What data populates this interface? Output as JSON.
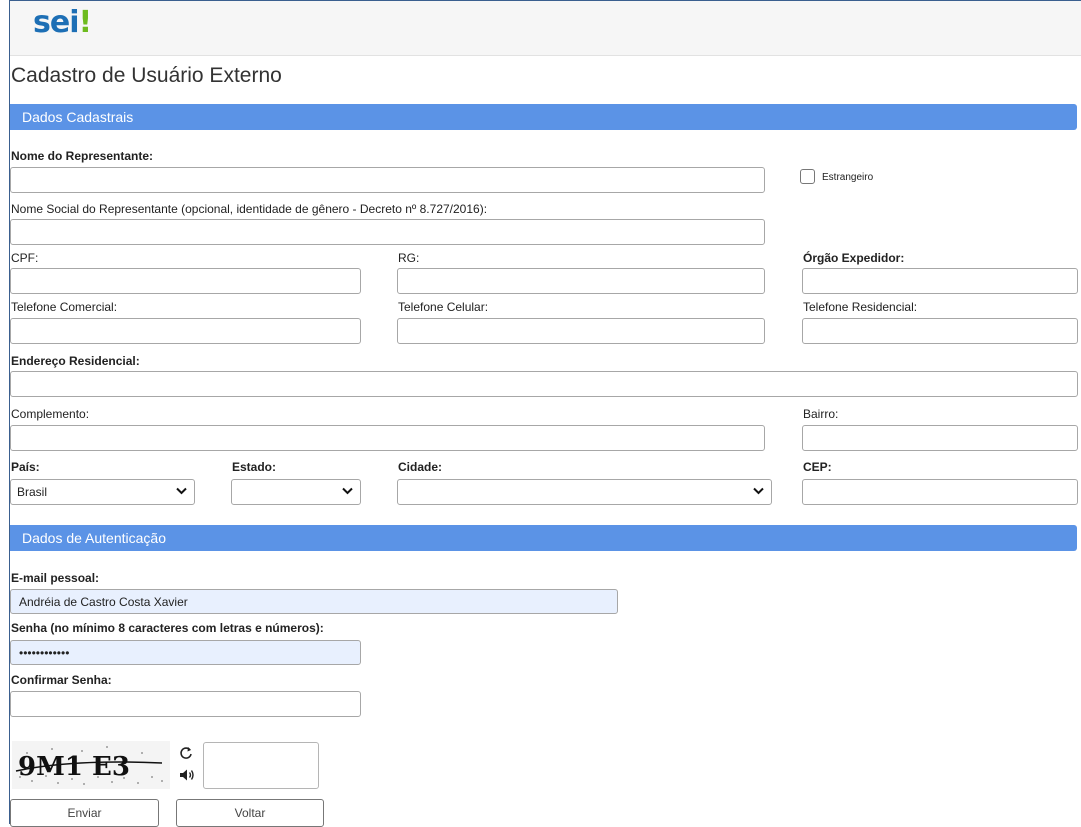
{
  "app": {
    "logo_main": "sei",
    "logo_mark": "!"
  },
  "page_title": "Cadastro de Usuário Externo",
  "sections": {
    "cadastrais": "Dados Cadastrais",
    "autenticacao": "Dados de Autenticação"
  },
  "labels": {
    "nome": "Nome do Representante:",
    "estrangeiro": "Estrangeiro",
    "nome_social": "Nome Social do Representante (opcional, identidade de gênero - Decreto nº 8.727/2016):",
    "cpf": "CPF:",
    "rg": "RG:",
    "orgao": "Órgão Expedidor:",
    "tel_comercial": "Telefone Comercial:",
    "tel_celular": "Telefone Celular:",
    "tel_residencial": "Telefone Residencial:",
    "endereco": "Endereço Residencial:",
    "complemento": "Complemento:",
    "bairro": "Bairro:",
    "pais": "País:",
    "estado": "Estado:",
    "cidade": "Cidade:",
    "cep": "CEP:",
    "email": "E-mail pessoal:",
    "senha": "Senha (no mínimo 8 caracteres com letras e números):",
    "confirmar": "Confirmar Senha:"
  },
  "values": {
    "pais": "Brasil",
    "estado": "",
    "cidade": "",
    "email": "Andréia de Castro Costa Xavier",
    "senha": "••••••••••••"
  },
  "captcha": {
    "text": "9M1 E3",
    "refresh_icon": "refresh-icon",
    "audio_icon": "speaker-icon"
  },
  "buttons": {
    "enviar": "Enviar",
    "voltar": "Voltar"
  }
}
